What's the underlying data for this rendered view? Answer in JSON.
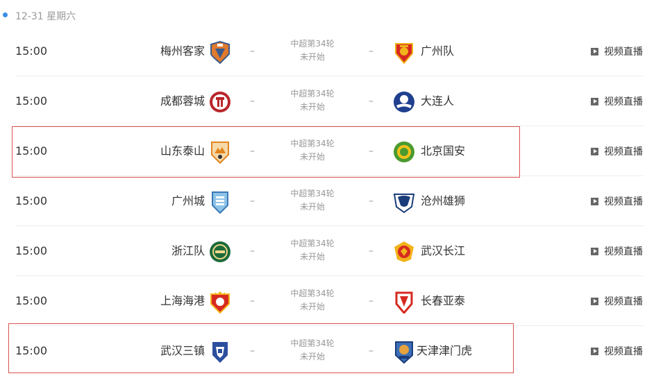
{
  "date": {
    "label": "12-31 星期六"
  },
  "accent_color": "#3a8ee6",
  "highlight_color": "#d9534f",
  "matches": [
    {
      "time": "15:00",
      "home": "梅州客家",
      "home_logo_icon": "meizhou-hakka-crest-icon",
      "round": "中超第34轮",
      "status": "未开始",
      "away": "广州队",
      "away_logo_icon": "guangzhou-fc-crest-icon",
      "video": "视频直播"
    },
    {
      "time": "15:00",
      "home": "成都蓉城",
      "home_logo_icon": "chengdu-rongcheng-crest-icon",
      "round": "中超第34轮",
      "status": "未开始",
      "away": "大连人",
      "away_logo_icon": "dalian-pro-crest-icon",
      "video": "视频直播"
    },
    {
      "time": "15:00",
      "home": "山东泰山",
      "home_logo_icon": "shandong-taishan-crest-icon",
      "round": "中超第34轮",
      "status": "未开始",
      "away": "北京国安",
      "away_logo_icon": "beijing-guoan-crest-icon",
      "video": "视频直播"
    },
    {
      "time": "15:00",
      "home": "广州城",
      "home_logo_icon": "guangzhou-city-crest-icon",
      "round": "中超第34轮",
      "status": "未开始",
      "away": "沧州雄狮",
      "away_logo_icon": "cangzhou-lions-crest-icon",
      "video": "视频直播"
    },
    {
      "time": "15:00",
      "home": "浙江队",
      "home_logo_icon": "zhejiang-fc-crest-icon",
      "round": "中超第34轮",
      "status": "未开始",
      "away": "武汉长江",
      "away_logo_icon": "wuhan-yangtze-crest-icon",
      "video": "视频直播"
    },
    {
      "time": "15:00",
      "home": "上海海港",
      "home_logo_icon": "shanghai-port-crest-icon",
      "round": "中超第34轮",
      "status": "未开始",
      "away": "长春亚泰",
      "away_logo_icon": "changchun-yatai-crest-icon",
      "video": "视频直播"
    },
    {
      "time": "15:00",
      "home": "武汉三镇",
      "home_logo_icon": "wuhan-three-towns-crest-icon",
      "round": "中超第34轮",
      "status": "未开始",
      "away": "天津津门虎",
      "away_logo_icon": "tianjin-jinmen-tiger-crest-icon",
      "video": "视频直播"
    }
  ],
  "separator": "–"
}
